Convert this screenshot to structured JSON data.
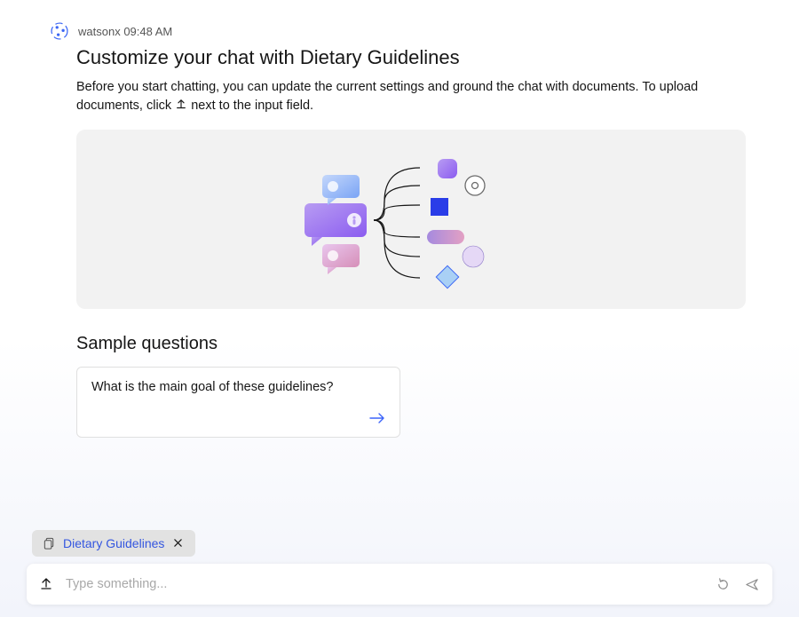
{
  "header": {
    "sender": "watsonx",
    "time": "09:48 AM"
  },
  "main": {
    "title": "Customize your chat with Dietary Guidelines",
    "description_pre": "Before you start chatting, you can update the current settings and ground the chat with documents. To upload documents, click ",
    "description_post": " next to the input field."
  },
  "sample": {
    "heading": "Sample questions",
    "items": [
      {
        "text": "What is the main goal of these guidelines?"
      }
    ]
  },
  "attachment": {
    "label": "Dietary Guidelines"
  },
  "input": {
    "placeholder": "Type something..."
  }
}
